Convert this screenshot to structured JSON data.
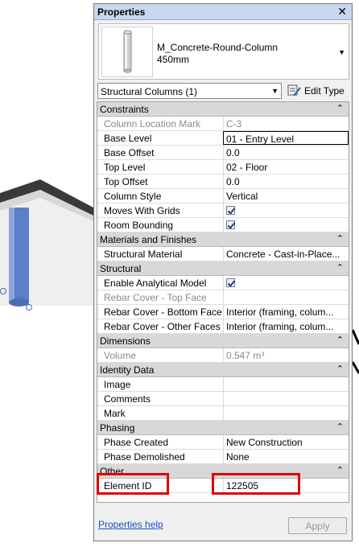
{
  "panel": {
    "title": "Properties",
    "close": "✕"
  },
  "type_selector": {
    "family": "M_Concrete-Round-Column",
    "type": "450mm",
    "arrow": "▼"
  },
  "filter": {
    "label": "Structural Columns (1)",
    "arrow": "▼",
    "edit_type_label": "Edit Type"
  },
  "groups": [
    {
      "label": "Constraints"
    },
    {
      "label": "Materials and Finishes"
    },
    {
      "label": "Structural"
    },
    {
      "label": "Dimensions"
    },
    {
      "label": "Identity Data"
    },
    {
      "label": "Phasing"
    },
    {
      "label": "Other"
    }
  ],
  "chevron": "⌃",
  "rows": {
    "column_location_mark": {
      "name": "Column Location Mark",
      "value": "C-3"
    },
    "base_level": {
      "name": "Base Level",
      "value": "01 - Entry Level"
    },
    "base_offset": {
      "name": "Base Offset",
      "value": "0.0"
    },
    "top_level": {
      "name": "Top Level",
      "value": "02 - Floor"
    },
    "top_offset": {
      "name": "Top Offset",
      "value": "0.0"
    },
    "column_style": {
      "name": "Column Style",
      "value": "Vertical"
    },
    "moves_with_grids": {
      "name": "Moves With Grids",
      "checked": true
    },
    "room_bounding": {
      "name": "Room Bounding",
      "checked": true
    },
    "structural_material": {
      "name": "Structural Material",
      "value": "Concrete - Cast-in-Place..."
    },
    "enable_analytical_model": {
      "name": "Enable Analytical Model",
      "checked": true
    },
    "rebar_cover_top": {
      "name": "Rebar Cover - Top Face",
      "value": ""
    },
    "rebar_cover_bottom": {
      "name": "Rebar Cover - Bottom Face",
      "value": "Interior (framing, colum..."
    },
    "rebar_cover_other": {
      "name": "Rebar Cover - Other Faces",
      "value": "Interior (framing, colum..."
    },
    "volume": {
      "name": "Volume",
      "value": "0.547 m³"
    },
    "image": {
      "name": "Image",
      "value": ""
    },
    "comments": {
      "name": "Comments",
      "value": ""
    },
    "mark": {
      "name": "Mark",
      "value": ""
    },
    "phase_created": {
      "name": "Phase Created",
      "value": "New Construction"
    },
    "phase_demolished": {
      "name": "Phase Demolished",
      "value": "None"
    },
    "element_id": {
      "name": "Element ID",
      "value": "122505"
    }
  },
  "footer": {
    "help_link": "Properties help",
    "apply_label": "Apply"
  },
  "colors": {
    "highlight": "#e00000",
    "column": "#5b7fc8",
    "wall": "#3a3a3a"
  }
}
